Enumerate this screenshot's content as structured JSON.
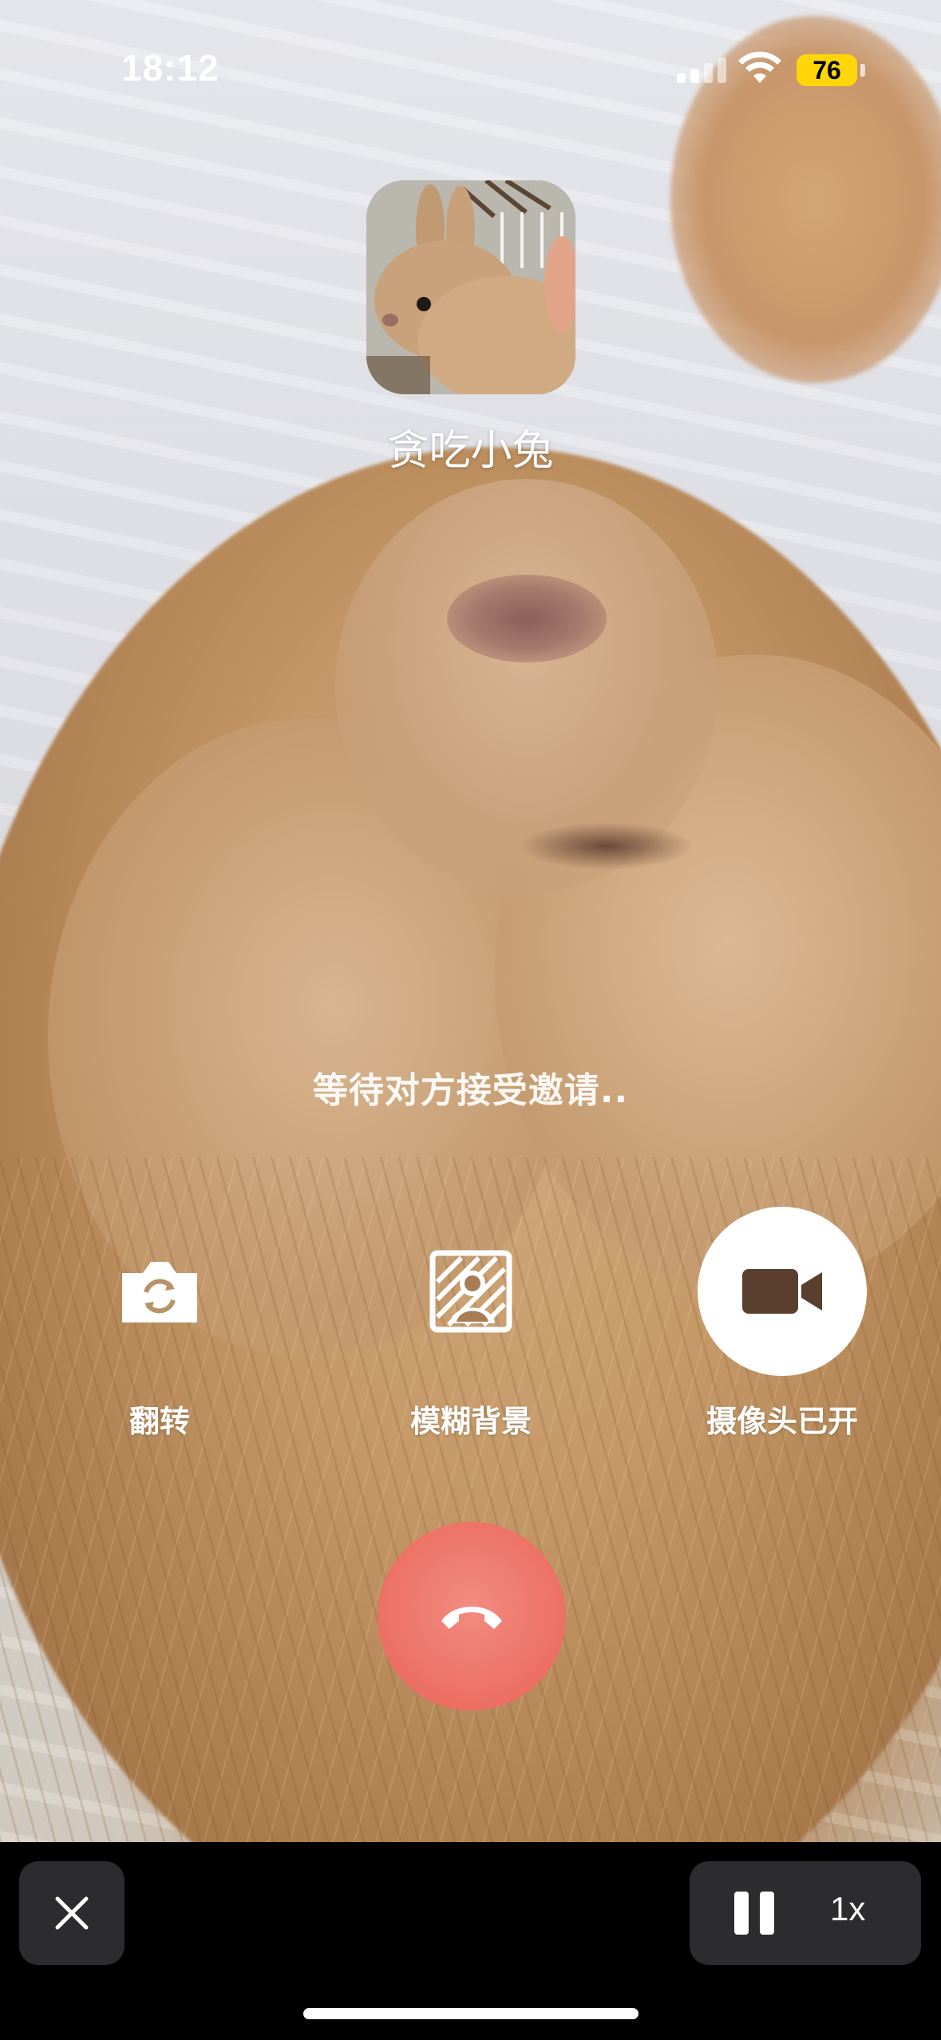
{
  "status_bar": {
    "time": "18:12",
    "battery_percent": "76",
    "signal_icon": "cellular-signal-icon",
    "wifi_icon": "wifi-icon",
    "battery_color": "#ffd60a"
  },
  "call": {
    "caller_name": "贪吃小兔",
    "status_text": "等待对方接受邀请..",
    "controls": [
      {
        "label": "翻转",
        "icon": "camera-flip-icon"
      },
      {
        "label": "模糊背景",
        "icon": "blur-background-icon"
      },
      {
        "label": "摄像头已开",
        "icon": "video-camera-icon"
      }
    ],
    "end_call_icon": "hang-up-icon",
    "end_call_color": "#ec6f62"
  },
  "player_bar": {
    "close_icon": "close-icon",
    "pause_icon": "pause-icon",
    "speed": "1x"
  }
}
